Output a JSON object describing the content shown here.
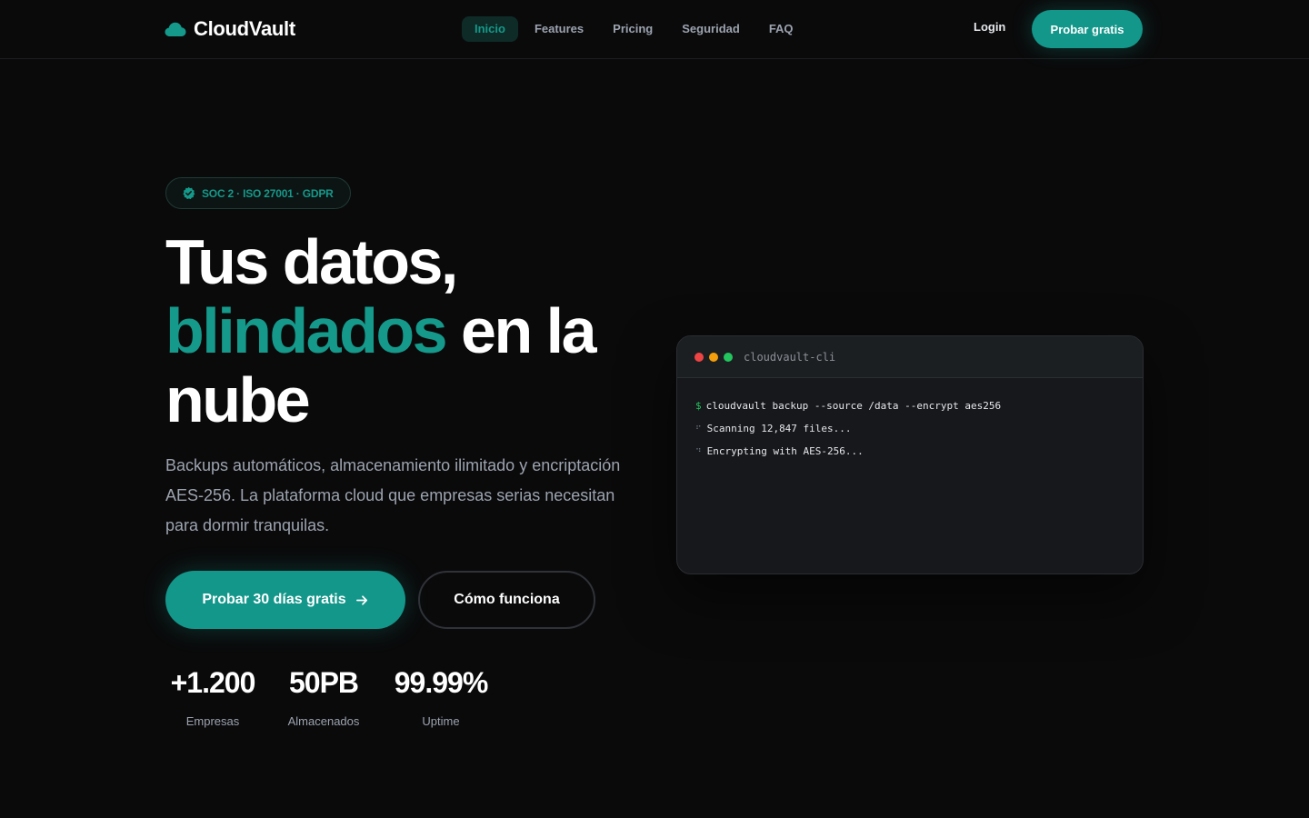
{
  "brand": {
    "name": "CloudVault",
    "icon": "cloud-icon",
    "color": "#14998a"
  },
  "nav": {
    "items": [
      {
        "label": "Inicio",
        "active": true
      },
      {
        "label": "Features",
        "active": false
      },
      {
        "label": "Pricing",
        "active": false
      },
      {
        "label": "Seguridad",
        "active": false
      },
      {
        "label": "FAQ",
        "active": false
      }
    ],
    "login_label": "Login",
    "cta_label": "Probar gratis"
  },
  "hero": {
    "badge": "SOC 2 · ISO 27001 · GDPR",
    "badge_icon": "verified-check-icon",
    "headline_line1": "Tus datos,",
    "headline_accent": "blindados",
    "headline_line2_rest": " en la",
    "headline_line3": "nube",
    "lead": "Backups automáticos, almacenamiento ilimitado y encriptación AES-256. La plataforma cloud que empresas serias necesitan para dormir tranquilas.",
    "primary_cta": "Probar 30 días gratis",
    "primary_cta_icon": "arrow-right-icon",
    "secondary_cta": "Cómo funciona"
  },
  "stats": [
    {
      "value": "+1.200",
      "label": "Empresas"
    },
    {
      "value": "50PB",
      "label": "Almacenados"
    },
    {
      "value": "99.99%",
      "label": "Uptime"
    }
  ],
  "terminal": {
    "title": "cloudvault-cli",
    "prompt": "$",
    "command": "cloudvault backup --source /data --encrypt aes256",
    "lines": [
      {
        "spinner": "⠋",
        "text": "Scanning 12,847 files..."
      },
      {
        "spinner": "⠙",
        "text": "Encrypting with AES-256..."
      }
    ]
  },
  "colors": {
    "accent": "#14998a",
    "background": "#0a0a0b",
    "terminal_red": "#ef4444",
    "terminal_yellow": "#f59e0b",
    "terminal_green": "#22c55e"
  }
}
